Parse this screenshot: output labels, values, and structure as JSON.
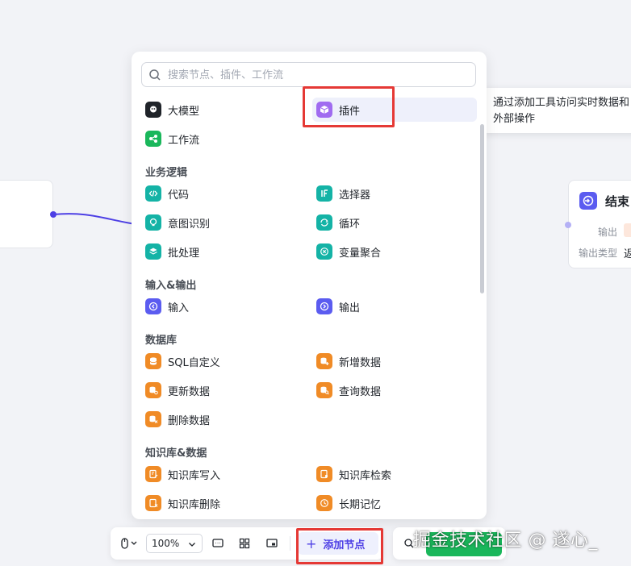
{
  "search": {
    "placeholder": "搜索节点、插件、工作流"
  },
  "top_items": [
    {
      "label": "大模型",
      "icon": "llm-icon"
    },
    {
      "label": "插件",
      "icon": "plugin-cube-icon"
    },
    {
      "label": "工作流",
      "icon": "workflow-icon"
    }
  ],
  "sections": [
    {
      "title": "业务逻辑",
      "items": [
        {
          "label": "代码",
          "icon": "code-icon"
        },
        {
          "label": "选择器",
          "icon": "if-selector-icon"
        },
        {
          "label": "意图识别",
          "icon": "intent-bulb-icon"
        },
        {
          "label": "循环",
          "icon": "loop-icon"
        },
        {
          "label": "批处理",
          "icon": "batch-layers-icon"
        },
        {
          "label": "变量聚合",
          "icon": "variable-merge-icon"
        }
      ]
    },
    {
      "title": "输入&输出",
      "items": [
        {
          "label": "输入",
          "icon": "input-icon"
        },
        {
          "label": "输出",
          "icon": "output-icon"
        }
      ]
    },
    {
      "title": "数据库",
      "items": [
        {
          "label": "SQL自定义",
          "icon": "database-icon"
        },
        {
          "label": "新增数据",
          "icon": "database-add-icon"
        },
        {
          "label": "更新数据",
          "icon": "database-update-icon"
        },
        {
          "label": "查询数据",
          "icon": "database-query-icon"
        },
        {
          "label": "删除数据",
          "icon": "database-delete-icon"
        }
      ]
    },
    {
      "title": "知识库&数据",
      "items": [
        {
          "label": "知识库写入",
          "icon": "knowledge-write-icon"
        },
        {
          "label": "知识库检索",
          "icon": "knowledge-search-icon"
        },
        {
          "label": "知识库删除",
          "icon": "knowledge-delete-icon"
        },
        {
          "label": "长期记忆",
          "icon": "memory-icon"
        }
      ]
    }
  ],
  "tooltip": {
    "line1": "通过添加工具访问实时数据和",
    "line2": "外部操作"
  },
  "end_node": {
    "title": "结束",
    "output_label": "输出",
    "output_type_label": "输出类型",
    "output_type_value": "返"
  },
  "toolbar": {
    "zoom": "100%",
    "add_node_label": "添加节点"
  },
  "colors": {
    "accent": "#4e40e5",
    "green": "#1ab75b",
    "orange": "#f08b26",
    "teal": "#14b3a6",
    "annotation_red": "#e53935"
  },
  "watermark": "掘金技术社区 @ 遂心_"
}
